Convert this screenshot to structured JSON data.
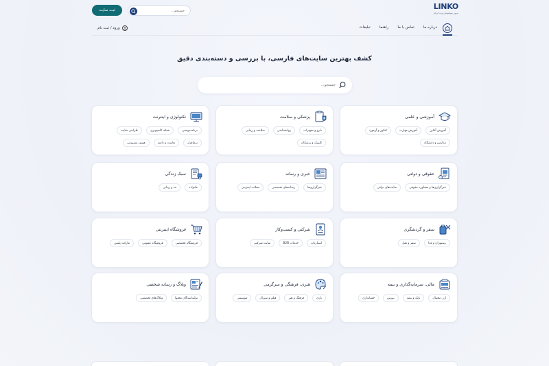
{
  "header": {
    "logo_text": "LINKO",
    "logo_tagline": "مرور موضوعی وب ایران",
    "register_button": "ثبت سایت",
    "search_placeholder": "جستجو..."
  },
  "nav": {
    "links": [
      "درباره ما",
      "تماس با ما",
      "راهنما",
      "تبلیغات"
    ],
    "login_label": "ورود / ثبت نام"
  },
  "hero": {
    "title": "کشف بهترین سایت‌های فارسی، با بررسی و دسته‌بندی دقیق",
    "search_placeholder": "جستجو..."
  },
  "categories": [
    {
      "title": "آموزشی و علمی",
      "icon": "graduation-cap-icon",
      "tags": [
        "آموزش آنلاین",
        "آموزش مهارت",
        "کنکور و آزمون",
        "مدارس و دانشگاه"
      ]
    },
    {
      "title": "پزشکی و سلامت",
      "icon": "medical-clipboard-icon",
      "tags": [
        "دارو و تجهیزات",
        "روانشناسی",
        "سلامت و زیبایی",
        "کلینیک و پزشکان"
      ]
    },
    {
      "title": "تکنولوژی و اینترنت",
      "icon": "monitor-icon",
      "tags": [
        "برنامه‌نویسی",
        "شبکه کامپیوتری",
        "طراحی سایت",
        "نرم‌افزار",
        "هاست و دامنه",
        "هوش مصنوعی"
      ]
    },
    {
      "title": "حقوقی و دولتی",
      "icon": "legal-document-icon",
      "tags": [
        "خبرگزاری‌ها و مشاوره حقوقی",
        "سایت‌های دولتی"
      ]
    },
    {
      "title": "خبری و رسانه",
      "icon": "newspaper-icon",
      "tags": [
        "خبرگزاری‌ها",
        "رسانه‌های تخصصی",
        "مجلات اینترنتی"
      ]
    },
    {
      "title": "سبک زندگی",
      "icon": "lifestyle-icon",
      "tags": [
        "خانواده",
        "مد و زیبایی"
      ]
    },
    {
      "title": "سفر و گردشگری",
      "icon": "travel-icon",
      "tags": [
        "رستوران و غذا",
        "سفر و هتل"
      ]
    },
    {
      "title": "شرکتی و کسب‌وکار",
      "icon": "business-icon",
      "tags": [
        "استارتاپ",
        "خدمات B2B",
        "سایت شرکتی"
      ]
    },
    {
      "title": "فروشگاه اینترنتی",
      "icon": "shopping-cart-icon",
      "tags": [
        "فروشگاه تخصصی",
        "فروشگاه عمومی",
        "مارکت پلیس"
      ]
    },
    {
      "title": "مالی، سرمایه‌گذاری و بیمه",
      "icon": "finance-icon",
      "tags": [
        "ارز دیجیتال",
        "بانک و بیمه",
        "بورس",
        "حسابداری"
      ]
    },
    {
      "title": "هنری، فرهنگی و سرگرمی",
      "icon": "art-palette-icon",
      "tags": [
        "بازی",
        "فرهنگ و هنر",
        "فیلم و سریال",
        "موسیقی"
      ]
    },
    {
      "title": "وبلاگ و رسانه شخصی",
      "icon": "blog-icon",
      "tags": [
        "تولیدکنندگان محتوا",
        "وبلاگ‌های تخصصی"
      ]
    }
  ],
  "colors": {
    "primary": "#116b73",
    "navy": "#1d3f7a",
    "icon_accent": "#4a86c8"
  }
}
